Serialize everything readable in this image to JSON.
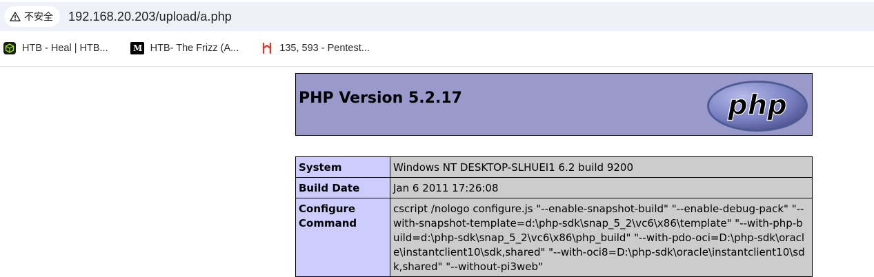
{
  "browser": {
    "security_label": "不安全",
    "url": "192.168.20.203/upload/a.php",
    "bookmarks": [
      {
        "icon": "htb-icon",
        "label": "HTB - Heal | HTB..."
      },
      {
        "icon": "medium-icon",
        "label": "HTB- The Frizz (A..."
      },
      {
        "icon": "pentest-icon",
        "label": "135, 593 - Pentest..."
      }
    ]
  },
  "phpinfo": {
    "title": "PHP Version 5.2.17",
    "logo_text": "php",
    "colors": {
      "header_bg": "#9999cc",
      "key_bg": "#ccccff",
      "value_bg": "#cccccc"
    },
    "rows": [
      {
        "key": "System",
        "value": "Windows NT DESKTOP-SLHUEI1 6.2 build 9200"
      },
      {
        "key": "Build Date",
        "value": "Jan 6 2011 17:26:08"
      },
      {
        "key": "Configure Command",
        "value": "cscript /nologo configure.js \"--enable-snapshot-build\" \"--enable-debug-pack\" \"--with-snapshot-template=d:\\php-sdk\\snap_5_2\\vc6\\x86\\template\" \"--with-php-build=d:\\php-sdk\\snap_5_2\\vc6\\x86\\php_build\" \"--with-pdo-oci=D:\\php-sdk\\oracle\\instantclient10\\sdk,shared\" \"--with-oci8=D:\\php-sdk\\oracle\\instantclient10\\sdk,shared\" \"--without-pi3web\""
      }
    ]
  }
}
